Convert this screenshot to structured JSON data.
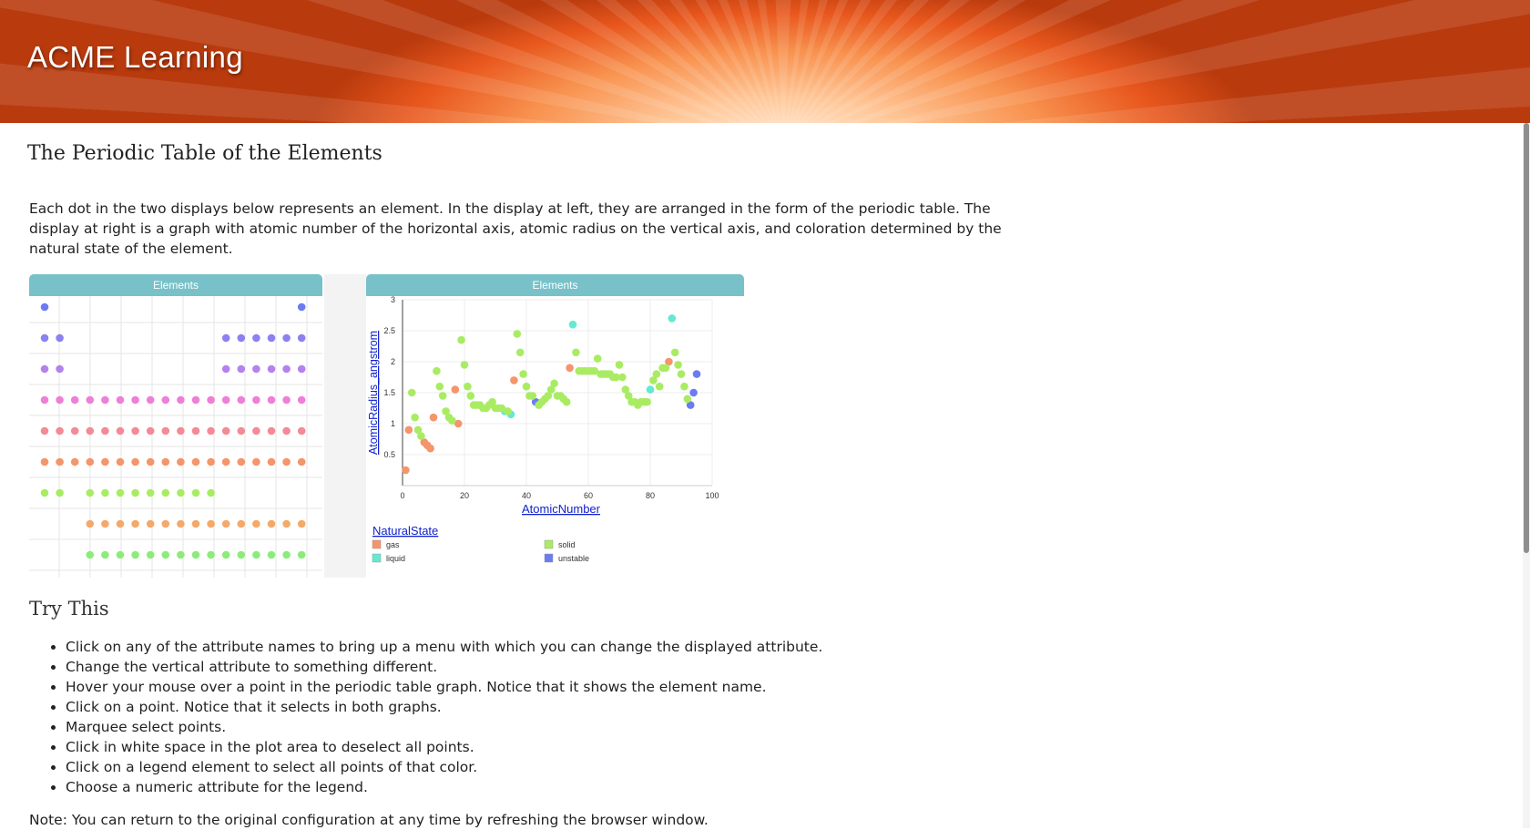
{
  "header": {
    "brand": "ACME Learning"
  },
  "page": {
    "title": "The Periodic Table of the Elements",
    "intro": "Each dot in the two displays below represents an element. In the display at left, they are arranged in the form of the periodic table. The display at right is a graph with atomic number of the horizontal axis, atomic radius on the vertical axis, and coloration determined by the natural state of the element."
  },
  "colors": {
    "gas": "#f4956b",
    "liquid": "#64e9d2",
    "solid": "#a9ec63",
    "unstable": "#6b7cf1",
    "header_teal": "#79c1c9",
    "banner": "#e8571d"
  },
  "left_panel": {
    "title": "Elements"
  },
  "right_panel": {
    "title": "Elements",
    "legend_title": "NaturalState"
  },
  "legend": [
    {
      "label": "gas",
      "color": "#f4956b"
    },
    {
      "label": "solid",
      "color": "#a9ec63"
    },
    {
      "label": "liquid",
      "color": "#64e9d2"
    },
    {
      "label": "unstable",
      "color": "#6b7cf1"
    }
  ],
  "try_this": {
    "heading": "Try This",
    "items": [
      "Click on any of the attribute names to bring up a menu with which you can change the displayed attribute.",
      "Change the vertical attribute to something different.",
      "Hover your mouse over a point in the periodic table graph. Notice that it shows the element name.",
      "Click on a point. Notice that it selects in both graphs.",
      "Marquee select points.",
      "Click in white space in the plot area to deselect all points.",
      "Click on a legend element to select all points of that color.",
      "Choose a numeric attribute for the legend."
    ]
  },
  "note": "Note: You can return to the original configuration at any time by refreshing the browser window.",
  "chart_data": [
    {
      "type": "scatter",
      "title": "Elements",
      "layout": "periodic-table",
      "row_colors": [
        "#6b7cf1",
        "#8d80f0",
        "#b482ee",
        "#ee7fd6",
        "#f48a94",
        "#f4956b",
        "#a9ec63",
        "#f4a96b",
        "#8cec7a"
      ],
      "rows": [
        {
          "row": 1,
          "cols": [
            1,
            18
          ]
        },
        {
          "row": 2,
          "cols": [
            1,
            2,
            13,
            14,
            15,
            16,
            17,
            18
          ]
        },
        {
          "row": 3,
          "cols": [
            1,
            2,
            13,
            14,
            15,
            16,
            17,
            18
          ]
        },
        {
          "row": 4,
          "cols": [
            1,
            2,
            3,
            4,
            5,
            6,
            7,
            8,
            9,
            10,
            11,
            12,
            13,
            14,
            15,
            16,
            17,
            18
          ]
        },
        {
          "row": 5,
          "cols": [
            1,
            2,
            3,
            4,
            5,
            6,
            7,
            8,
            9,
            10,
            11,
            12,
            13,
            14,
            15,
            16,
            17,
            18
          ]
        },
        {
          "row": 6,
          "cols": [
            1,
            2,
            3,
            4,
            5,
            6,
            7,
            8,
            9,
            10,
            11,
            12,
            13,
            14,
            15,
            16,
            17,
            18
          ]
        },
        {
          "row": 7,
          "cols": [
            1,
            2,
            4,
            5,
            6,
            7,
            8,
            9,
            10,
            11,
            12
          ]
        },
        {
          "row": 8,
          "cols": [
            4,
            5,
            6,
            7,
            8,
            9,
            10,
            11,
            12,
            13,
            14,
            15,
            16,
            17,
            18
          ]
        },
        {
          "row": 9,
          "cols": [
            4,
            5,
            6,
            7,
            8,
            9,
            10,
            11,
            12,
            13,
            14,
            15,
            16,
            17,
            18
          ]
        }
      ]
    },
    {
      "type": "scatter",
      "title": "Elements",
      "xlabel": "AtomicNumber",
      "ylabel": "AtomicRadius_angstrom",
      "xlim": [
        0,
        100
      ],
      "ylim": [
        0,
        3
      ],
      "xticks": [
        0,
        20,
        40,
        60,
        80,
        100
      ],
      "yticks": [
        0.5,
        1,
        1.5,
        2,
        2.5,
        3
      ],
      "legend_title": "NaturalState",
      "series": [
        {
          "name": "gas",
          "color": "#f4956b",
          "points": [
            [
              1,
              0.25
            ],
            [
              2,
              0.9
            ],
            [
              7,
              0.7
            ],
            [
              8,
              0.65
            ],
            [
              9,
              0.6
            ],
            [
              10,
              1.1
            ],
            [
              17,
              1.55
            ],
            [
              18,
              1.0
            ],
            [
              36,
              1.7
            ],
            [
              54,
              1.9
            ],
            [
              86,
              2.0
            ]
          ]
        },
        {
          "name": "liquid",
          "color": "#64e9d2",
          "points": [
            [
              33,
              1.2
            ],
            [
              35,
              1.15
            ],
            [
              55,
              2.6
            ],
            [
              80,
              1.55
            ],
            [
              87,
              2.7
            ]
          ]
        },
        {
          "name": "unstable",
          "color": "#6b7cf1",
          "points": [
            [
              43,
              1.35
            ],
            [
              95,
              1.8
            ],
            [
              94,
              1.5
            ],
            [
              93,
              1.3
            ]
          ]
        },
        {
          "name": "solid",
          "color": "#a9ec63",
          "points": [
            [
              3,
              1.5
            ],
            [
              4,
              1.1
            ],
            [
              5,
              0.9
            ],
            [
              6,
              0.8
            ],
            [
              11,
              1.85
            ],
            [
              12,
              1.6
            ],
            [
              13,
              1.45
            ],
            [
              14,
              1.2
            ],
            [
              15,
              1.1
            ],
            [
              16,
              1.05
            ],
            [
              19,
              2.35
            ],
            [
              20,
              1.95
            ],
            [
              21,
              1.6
            ],
            [
              22,
              1.45
            ],
            [
              23,
              1.3
            ],
            [
              24,
              1.3
            ],
            [
              25,
              1.3
            ],
            [
              26,
              1.25
            ],
            [
              27,
              1.25
            ],
            [
              28,
              1.3
            ],
            [
              29,
              1.35
            ],
            [
              30,
              1.25
            ],
            [
              31,
              1.25
            ],
            [
              32,
              1.25
            ],
            [
              34,
              1.2
            ],
            [
              37,
              2.45
            ],
            [
              38,
              2.15
            ],
            [
              39,
              1.8
            ],
            [
              40,
              1.6
            ],
            [
              41,
              1.45
            ],
            [
              42,
              1.45
            ],
            [
              44,
              1.3
            ],
            [
              45,
              1.35
            ],
            [
              46,
              1.4
            ],
            [
              47,
              1.45
            ],
            [
              48,
              1.55
            ],
            [
              49,
              1.65
            ],
            [
              50,
              1.45
            ],
            [
              51,
              1.45
            ],
            [
              52,
              1.4
            ],
            [
              53,
              1.35
            ],
            [
              56,
              2.15
            ],
            [
              57,
              1.85
            ],
            [
              58,
              1.85
            ],
            [
              59,
              1.85
            ],
            [
              60,
              1.85
            ],
            [
              61,
              1.85
            ],
            [
              62,
              1.85
            ],
            [
              63,
              2.05
            ],
            [
              64,
              1.8
            ],
            [
              65,
              1.8
            ],
            [
              66,
              1.8
            ],
            [
              67,
              1.8
            ],
            [
              68,
              1.75
            ],
            [
              69,
              1.75
            ],
            [
              70,
              1.95
            ],
            [
              71,
              1.75
            ],
            [
              72,
              1.55
            ],
            [
              73,
              1.45
            ],
            [
              74,
              1.35
            ],
            [
              75,
              1.35
            ],
            [
              76,
              1.3
            ],
            [
              77,
              1.35
            ],
            [
              78,
              1.35
            ],
            [
              79,
              1.35
            ],
            [
              81,
              1.7
            ],
            [
              82,
              1.8
            ],
            [
              83,
              1.6
            ],
            [
              84,
              1.9
            ],
            [
              85,
              1.9
            ],
            [
              88,
              2.15
            ],
            [
              89,
              1.95
            ],
            [
              90,
              1.8
            ],
            [
              91,
              1.6
            ],
            [
              92,
              1.4
            ]
          ]
        }
      ]
    }
  ]
}
